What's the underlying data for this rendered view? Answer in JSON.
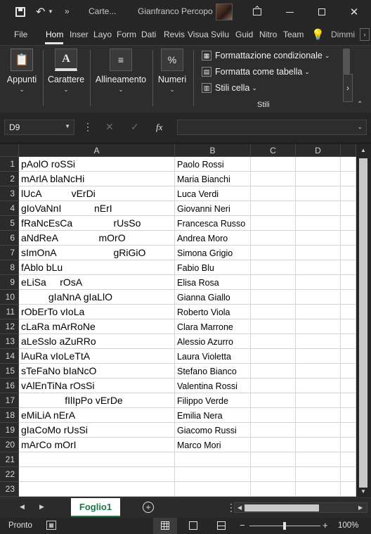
{
  "titlebar": {
    "save_icon": "save-icon",
    "undo_icon": "undo-icon",
    "more_icon": "chevron-double-right-icon",
    "doc_title": "Carte...",
    "user_name": "Gianfranco Percopo",
    "controls": [
      "restore-window-icon",
      "minimize-icon",
      "maximize-icon",
      "close-icon"
    ]
  },
  "menu": {
    "items": [
      "File",
      "Hom",
      "Inser",
      "Layo",
      "Form",
      "Dati",
      "Revis",
      "Visua",
      "Svilu",
      "Guid",
      "Nitro",
      "Team"
    ],
    "search_label": "Dimmi"
  },
  "ribbon": {
    "groups": [
      {
        "label": "Appunti",
        "icon": "clipboard-icon"
      },
      {
        "label": "Carattere",
        "icon": "font-color-icon"
      },
      {
        "label": "Allineamento",
        "icon": "align-icon"
      },
      {
        "label": "Numeri",
        "icon": "percent-icon"
      }
    ],
    "stili": {
      "items": [
        "Formattazione condizionale",
        "Formatta come tabella",
        "Stili cella"
      ],
      "group_label": "Stili"
    }
  },
  "formula_bar": {
    "name_box": "D9",
    "fx_label": "fx",
    "value": ""
  },
  "sheet": {
    "columns": [
      "A",
      "B",
      "C",
      "D"
    ],
    "rows": [
      {
        "n": "1",
        "a": "pAolO roSSi",
        "b": "Paolo Rossi"
      },
      {
        "n": "2",
        "a": "mArlA blaNcHi",
        "b": "Maria Bianchi"
      },
      {
        "n": "3",
        "a": "lUcA           vErDi",
        "b": "Luca Verdi"
      },
      {
        "n": "4",
        "a": "gIoVaNnI            nErI",
        "b": "Giovanni Neri"
      },
      {
        "n": "5",
        "a": "fRaNcEsCa               rUsSo",
        "b": "Francesca Russo"
      },
      {
        "n": "6",
        "a": "aNdReA               mOrO",
        "b": "Andrea Moro"
      },
      {
        "n": "7",
        "a": "sImOnA                     gRiGiO",
        "b": "Simona Grigio"
      },
      {
        "n": "8",
        "a": "fAblo bLu",
        "b": "Fabio Blu"
      },
      {
        "n": "9",
        "a": "eLiSa     rOsA",
        "b": "Elisa Rosa"
      },
      {
        "n": "10",
        "a": "          gIaNnA gIaLlO",
        "b": "Gianna Giallo"
      },
      {
        "n": "11",
        "a": "rObErTo vIoLa",
        "b": "Roberto Viola"
      },
      {
        "n": "12",
        "a": "cLaRa mArRoNe",
        "b": "Clara Marrone"
      },
      {
        "n": "13",
        "a": "aLeSslo aZuRRo",
        "b": "Alessio Azurro"
      },
      {
        "n": "14",
        "a": "lAuRa vIoLeTtA",
        "b": "Laura Violetta"
      },
      {
        "n": "15",
        "a": "sTeFaNo bIaNcO",
        "b": "Stefano Bianco"
      },
      {
        "n": "16",
        "a": "vAlEnTiNa rOsSi",
        "b": "Valentina Rossi"
      },
      {
        "n": "17",
        "a": "                fIlIpPo vErDe",
        "b": "Filippo Verde"
      },
      {
        "n": "18",
        "a": "eMiLiA nErA",
        "b": "Emilia Nera"
      },
      {
        "n": "19",
        "a": "gIaCoMo rUsSi",
        "b": "Giacomo Russi"
      },
      {
        "n": "20",
        "a": "mArCo mOrI",
        "b": "Marco Mori"
      },
      {
        "n": "21",
        "a": "",
        "b": ""
      },
      {
        "n": "22",
        "a": "",
        "b": ""
      },
      {
        "n": "23",
        "a": "",
        "b": ""
      }
    ]
  },
  "sheet_tabs": {
    "active": "Foglio1",
    "add_icon": "plus-circle-icon"
  },
  "status": {
    "mode": "Pronto",
    "zoom": "100%"
  }
}
